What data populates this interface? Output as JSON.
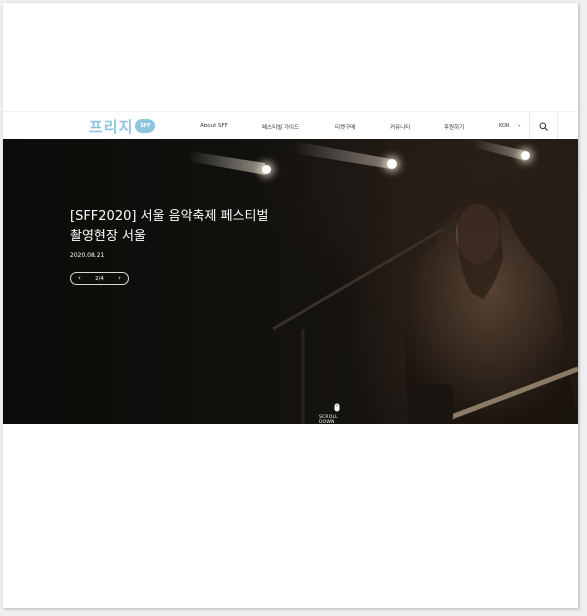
{
  "logo": {
    "text": "프리지",
    "badge": "SFF"
  },
  "nav": {
    "items": [
      {
        "label": "About SFF"
      },
      {
        "label": "페스티벌 가이드"
      },
      {
        "label": "티켓구매"
      },
      {
        "label": "커뮤니티"
      },
      {
        "label": "후원하기"
      }
    ],
    "language": "KOR",
    "search_icon": "search-icon"
  },
  "hero": {
    "title_line1": "[SFF2020] 서울 음악축제 페스티벌",
    "title_line2": "촬영현장 서울",
    "date": "2020.08.21",
    "pager": {
      "current": "2",
      "separator": "/",
      "total": "4"
    },
    "scroll_label": "SCROLL DOWN"
  },
  "colors": {
    "brand": "#8fc5e0",
    "hero_bg": "#0e0d0b",
    "text_light": "#ffffff"
  }
}
